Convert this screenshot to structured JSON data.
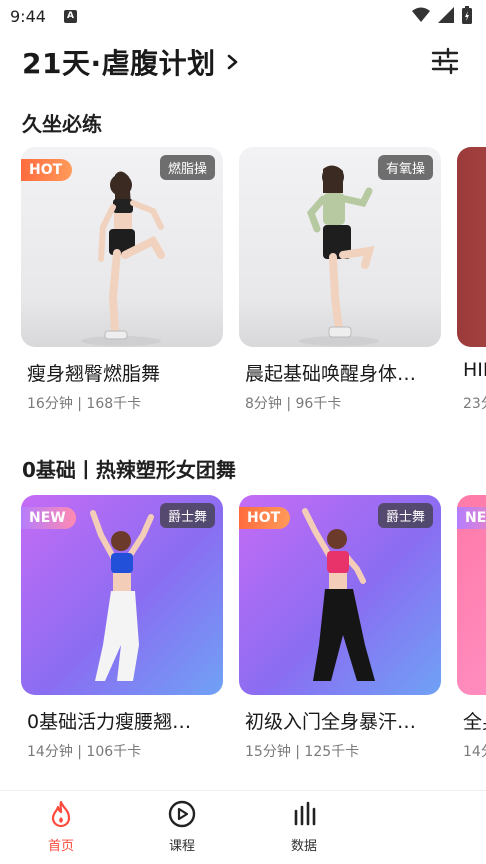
{
  "status_bar": {
    "time": "9:44",
    "left_icon": "A"
  },
  "header": {
    "title": "21天·虐腹计划"
  },
  "sections": [
    {
      "title": "久坐必练",
      "cards": [
        {
          "name": "瘦身翘臀燃脂舞",
          "meta": "16分钟 | 168千卡",
          "tag": "燃脂操",
          "badge": "HOT"
        },
        {
          "name": "晨起基础唤醒身体…",
          "meta": "8分钟 | 96千卡",
          "tag": "有氧操",
          "badge": ""
        },
        {
          "name": "HII",
          "meta": "23分",
          "tag": "",
          "badge": ""
        }
      ]
    },
    {
      "title": "0基础丨热辣塑形女团舞",
      "cards": [
        {
          "name": "0基础活力瘦腰翘…",
          "meta": "14分钟 | 106千卡",
          "tag": "爵士舞",
          "badge": "NEW"
        },
        {
          "name": "初级入门全身暴汗…",
          "meta": "15分钟 | 125千卡",
          "tag": "爵士舞",
          "badge": "HOT"
        },
        {
          "name": "全身",
          "meta": "14分",
          "tag": "",
          "badge": "NEW"
        }
      ]
    }
  ],
  "tabbar": {
    "items": [
      {
        "label": "首页",
        "icon": "flame-icon",
        "active": true
      },
      {
        "label": "课程",
        "icon": "play-circle-icon",
        "active": false
      },
      {
        "label": "数据",
        "icon": "bar-chart-icon",
        "active": false
      }
    ]
  },
  "colors": {
    "accent": "#ff4a3d",
    "hot_badge": "#ff6a3d",
    "new_badge": "#b27cff"
  }
}
